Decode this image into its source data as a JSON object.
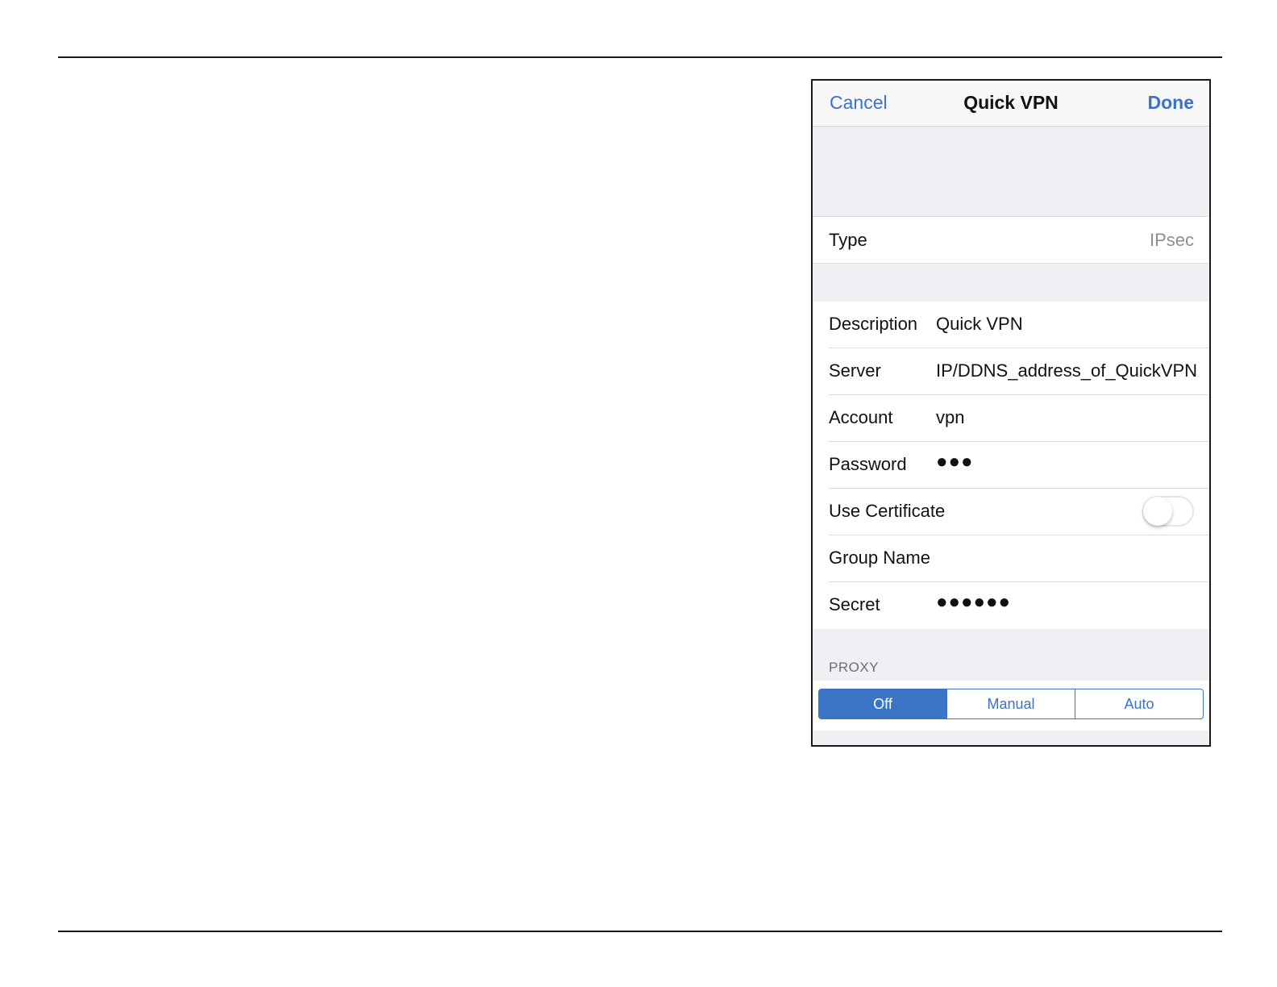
{
  "navbar": {
    "cancel_label": "Cancel",
    "title": "Quick VPN",
    "done_label": "Done"
  },
  "type_row": {
    "label": "Type",
    "value": "IPsec"
  },
  "fields": {
    "description": {
      "label": "Description",
      "value": "Quick VPN"
    },
    "server": {
      "label": "Server",
      "value": "IP/DDNS_address_of_QuickVPN"
    },
    "account": {
      "label": "Account",
      "value": "vpn"
    },
    "password": {
      "label": "Password",
      "value": "●●●"
    },
    "use_certificate": {
      "label": "Use Certificate",
      "enabled": false
    },
    "group_name": {
      "label": "Group Name",
      "value": ""
    },
    "secret": {
      "label": "Secret",
      "value": "●●●●●●"
    }
  },
  "proxy": {
    "header": "PROXY",
    "options": [
      "Off",
      "Manual",
      "Auto"
    ],
    "selected": "Off"
  },
  "colors": {
    "accent": "#3b73c7",
    "grouped_background": "#efeff4",
    "secondary_text": "#8e8e93"
  }
}
